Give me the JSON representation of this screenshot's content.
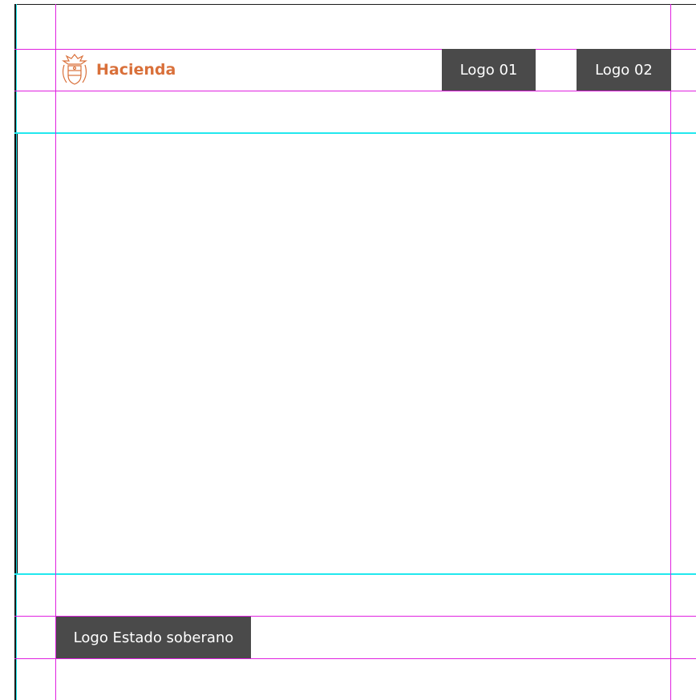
{
  "header": {
    "brand_name": "Hacienda",
    "logo_01": "Logo 01",
    "logo_02": "Logo 02"
  },
  "footer": {
    "logo_estado": "Logo Estado soberano"
  },
  "colors": {
    "brand_orange": "#d9703a",
    "logo_box": "#4a4a4a",
    "guide_magenta": "#e020e0",
    "guide_cyan": "#22e8ee"
  }
}
